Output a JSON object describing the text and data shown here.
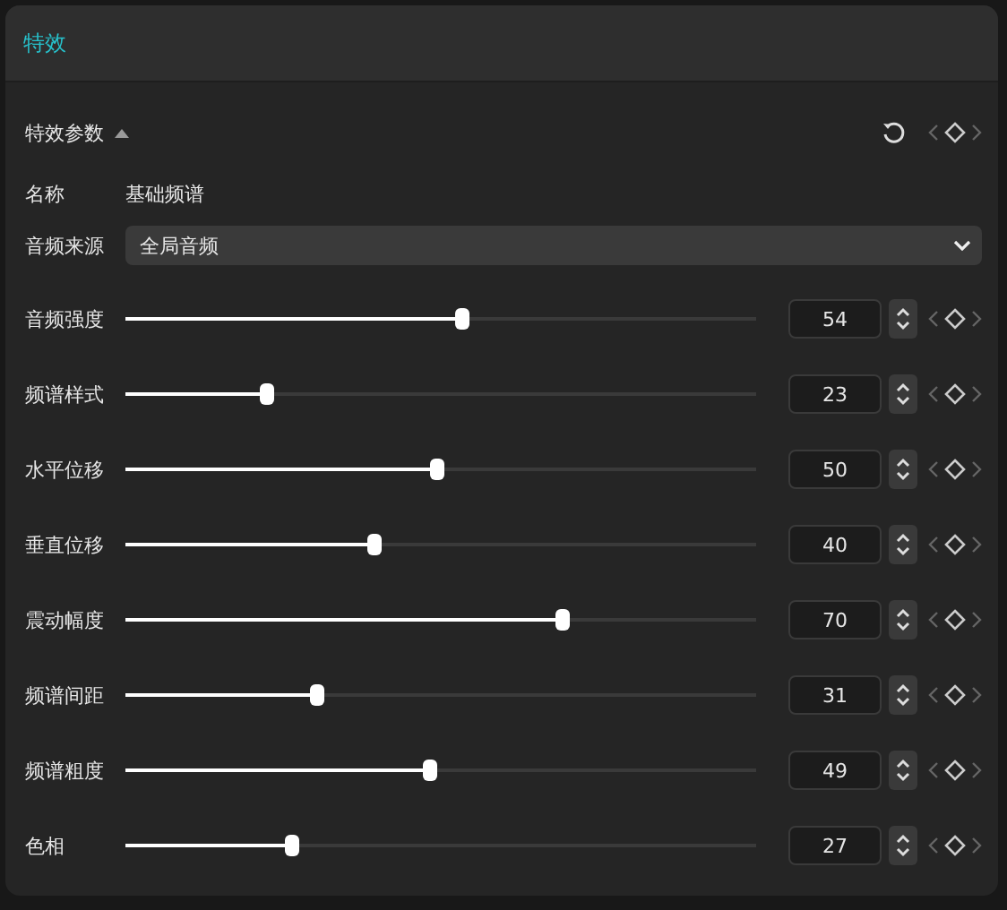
{
  "panel": {
    "title": "特效"
  },
  "section": {
    "title": "特效参数",
    "expanded": true
  },
  "name": {
    "label": "名称",
    "value": "基础频谱"
  },
  "audio_source": {
    "label": "音频来源",
    "value": "全局音频"
  },
  "sliders": [
    {
      "label": "音频强度",
      "level": 0.54,
      "value": "54"
    },
    {
      "label": "频谱样式",
      "level": 0.23,
      "value": "23"
    },
    {
      "label": "水平位移",
      "level": 0.5,
      "value": "50"
    },
    {
      "label": "垂直位移",
      "level": 0.4,
      "value": "40"
    },
    {
      "label": "震动幅度",
      "level": 0.7,
      "value": "70"
    },
    {
      "label": "频谱间距",
      "level": 0.31,
      "value": "31"
    },
    {
      "label": "频谱粗度",
      "level": 0.49,
      "value": "49"
    },
    {
      "label": "色相",
      "level": 0.27,
      "value": "27"
    }
  ]
}
